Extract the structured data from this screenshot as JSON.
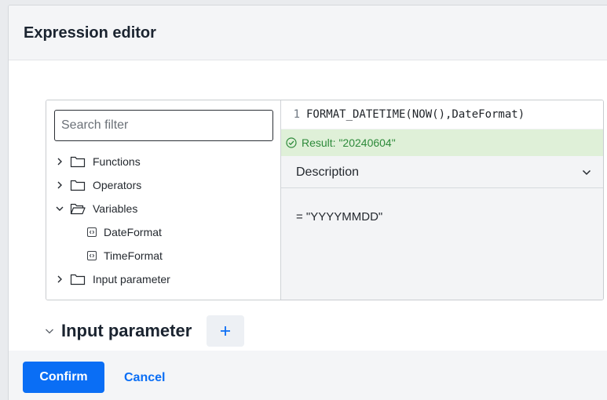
{
  "dialog": {
    "title": "Expression editor"
  },
  "tree": {
    "search_placeholder": "Search filter",
    "items": [
      {
        "label": "Functions",
        "state": "collapsed"
      },
      {
        "label": "Operators",
        "state": "collapsed"
      },
      {
        "label": "Variables",
        "state": "expanded",
        "children": [
          {
            "label": "DateFormat"
          },
          {
            "label": "TimeFormat"
          }
        ]
      },
      {
        "label": "Input parameter",
        "state": "collapsed"
      }
    ]
  },
  "editor": {
    "line_number": "1",
    "code": "FORMAT_DATETIME(NOW(),DateFormat)",
    "result": "Result: \"20240604\""
  },
  "description": {
    "title": "Description",
    "body": "= \"YYYYMMDD\""
  },
  "input_parameter": {
    "title": "Input parameter",
    "add_label": "+"
  },
  "footer": {
    "confirm_label": "Confirm",
    "cancel_label": "Cancel"
  },
  "colors": {
    "primary": "#0a6ef5",
    "result_bg": "#dff0d8",
    "result_text": "#2d8a3a"
  }
}
